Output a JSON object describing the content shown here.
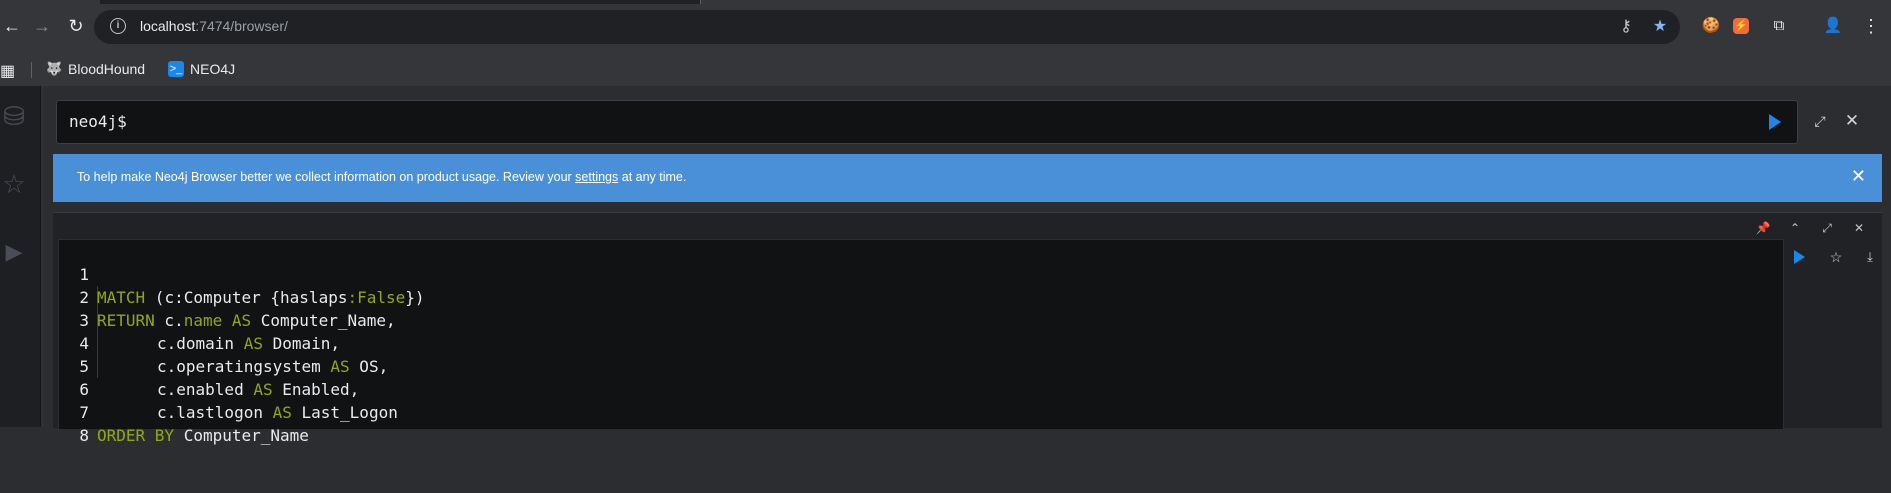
{
  "browser": {
    "url_host": "localhost",
    "url_path": ":7474/browser/",
    "bookmarks": [
      {
        "label": "BloodHound",
        "icon": "bloodhound-icon"
      },
      {
        "label": "NEO4J",
        "icon": "terminal-icon"
      }
    ]
  },
  "editor": {
    "prompt": "neo4j$"
  },
  "banner": {
    "text_before": "To help make Neo4j Browser better we collect information on product usage. Review your ",
    "link": "settings",
    "text_after": " at any time."
  },
  "query": {
    "lines": [
      {
        "num": "1"
      },
      {
        "num": "2"
      },
      {
        "num": "3"
      },
      {
        "num": "4"
      },
      {
        "num": "5"
      },
      {
        "num": "6"
      },
      {
        "num": "7"
      },
      {
        "num": "8"
      }
    ],
    "tokens": {
      "l1_kw": "MATCH",
      "l1_a": " (c:Computer {",
      "l1_prop": "haslaps",
      "l1_colon": ":",
      "l1_bool": "False",
      "l1_b": "})",
      "l2_kw": "RETURN",
      "l2_a": " c.",
      "l2_prop": "name",
      "l2_as": " AS",
      "l2_b": " Computer_Name,",
      "l3_a": "c.domain",
      "l3_as": " AS",
      "l3_b": " Domain,",
      "l4_a": "c.operatingsystem",
      "l4_as": " AS",
      "l4_b": " OS,",
      "l5_a": "c.enabled",
      "l5_as": " AS",
      "l5_b": " Enabled,",
      "l6_a": "c.lastlogon",
      "l6_as": " AS",
      "l6_b": " Last_Logon",
      "l7_kw": "ORDER BY",
      "l7_b": " Computer_Name"
    }
  },
  "colors": {
    "accent": "#1a87ea",
    "banner": "#4a90d9",
    "keyword": "#8fa81a"
  }
}
